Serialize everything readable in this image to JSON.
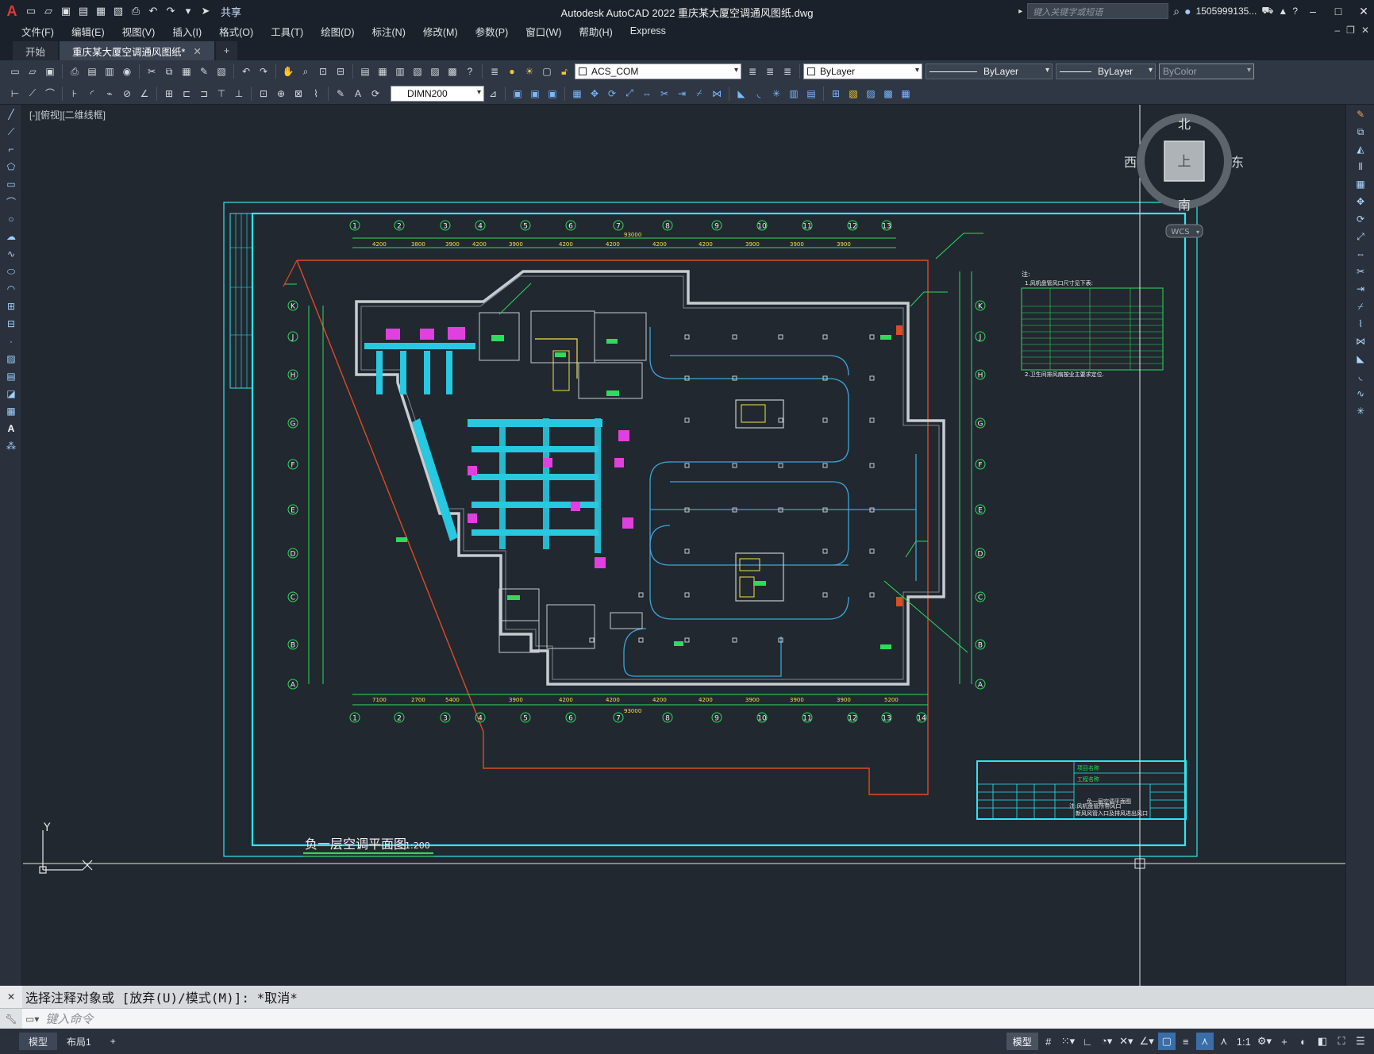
{
  "app": {
    "title": "Autodesk AutoCAD 2022    重庆某大厦空调通风图纸.dwg",
    "share_label": "共享",
    "search_placeholder": "键入关键字或短语",
    "user": "1505999135..."
  },
  "menu": [
    "文件(F)",
    "编辑(E)",
    "视图(V)",
    "插入(I)",
    "格式(O)",
    "工具(T)",
    "绘图(D)",
    "标注(N)",
    "修改(M)",
    "参数(P)",
    "窗口(W)",
    "帮助(H)",
    "Express"
  ],
  "tabs": [
    {
      "label": "开始",
      "active": false
    },
    {
      "label": "重庆某大厦空调通风图纸*",
      "active": true
    }
  ],
  "layer": {
    "current": "ACS_COM",
    "color": "ByLayer",
    "linetype": "ByLayer",
    "lineweight": "ByLayer",
    "plotstyle": "ByColor"
  },
  "dimstyle": "DIMN200",
  "viewport_label": "[-][俯视][二维线框]",
  "viewcube": {
    "north": "北",
    "south": "南",
    "east": "东",
    "west": "西",
    "face": "上",
    "wcs": "WCS"
  },
  "drawing": {
    "plan_title": "负一层空调平面图",
    "scale": "1:200",
    "grid_cols": [
      "1",
      "2",
      "3",
      "4",
      "5",
      "6",
      "7",
      "8",
      "9",
      "10",
      "11",
      "12",
      "13",
      "14"
    ],
    "grid_rows": [
      "K",
      "J",
      "H",
      "G",
      "F",
      "E",
      "D",
      "C",
      "B",
      "A"
    ],
    "dim_total_top": "93000",
    "dim_total_bottom": "93000",
    "notes_title": "注:",
    "notes_line1": "1.风机盘管风口尺寸见下表:",
    "notes_line2": "2.卫生间排风扇按业主要求定位.",
    "remark_line1": "注:风机盘管所带风口",
    "remark_line2": "新风风管入口及排风进出风口",
    "titleblock_project": "项目名称",
    "titleblock_work": "工程名称",
    "titleblock_drawing": "负一层空调平面图"
  },
  "axis": {
    "y": "Y",
    "x": "X"
  },
  "command": {
    "history": "选择注释对象或 [放弃(U)/模式(M)]: *取消*",
    "placeholder": "键入命令"
  },
  "status": {
    "layout_tabs": [
      {
        "label": "模型",
        "active": true
      },
      {
        "label": "布局1",
        "active": false
      }
    ],
    "model_label": "模型",
    "scale": "1:1"
  }
}
